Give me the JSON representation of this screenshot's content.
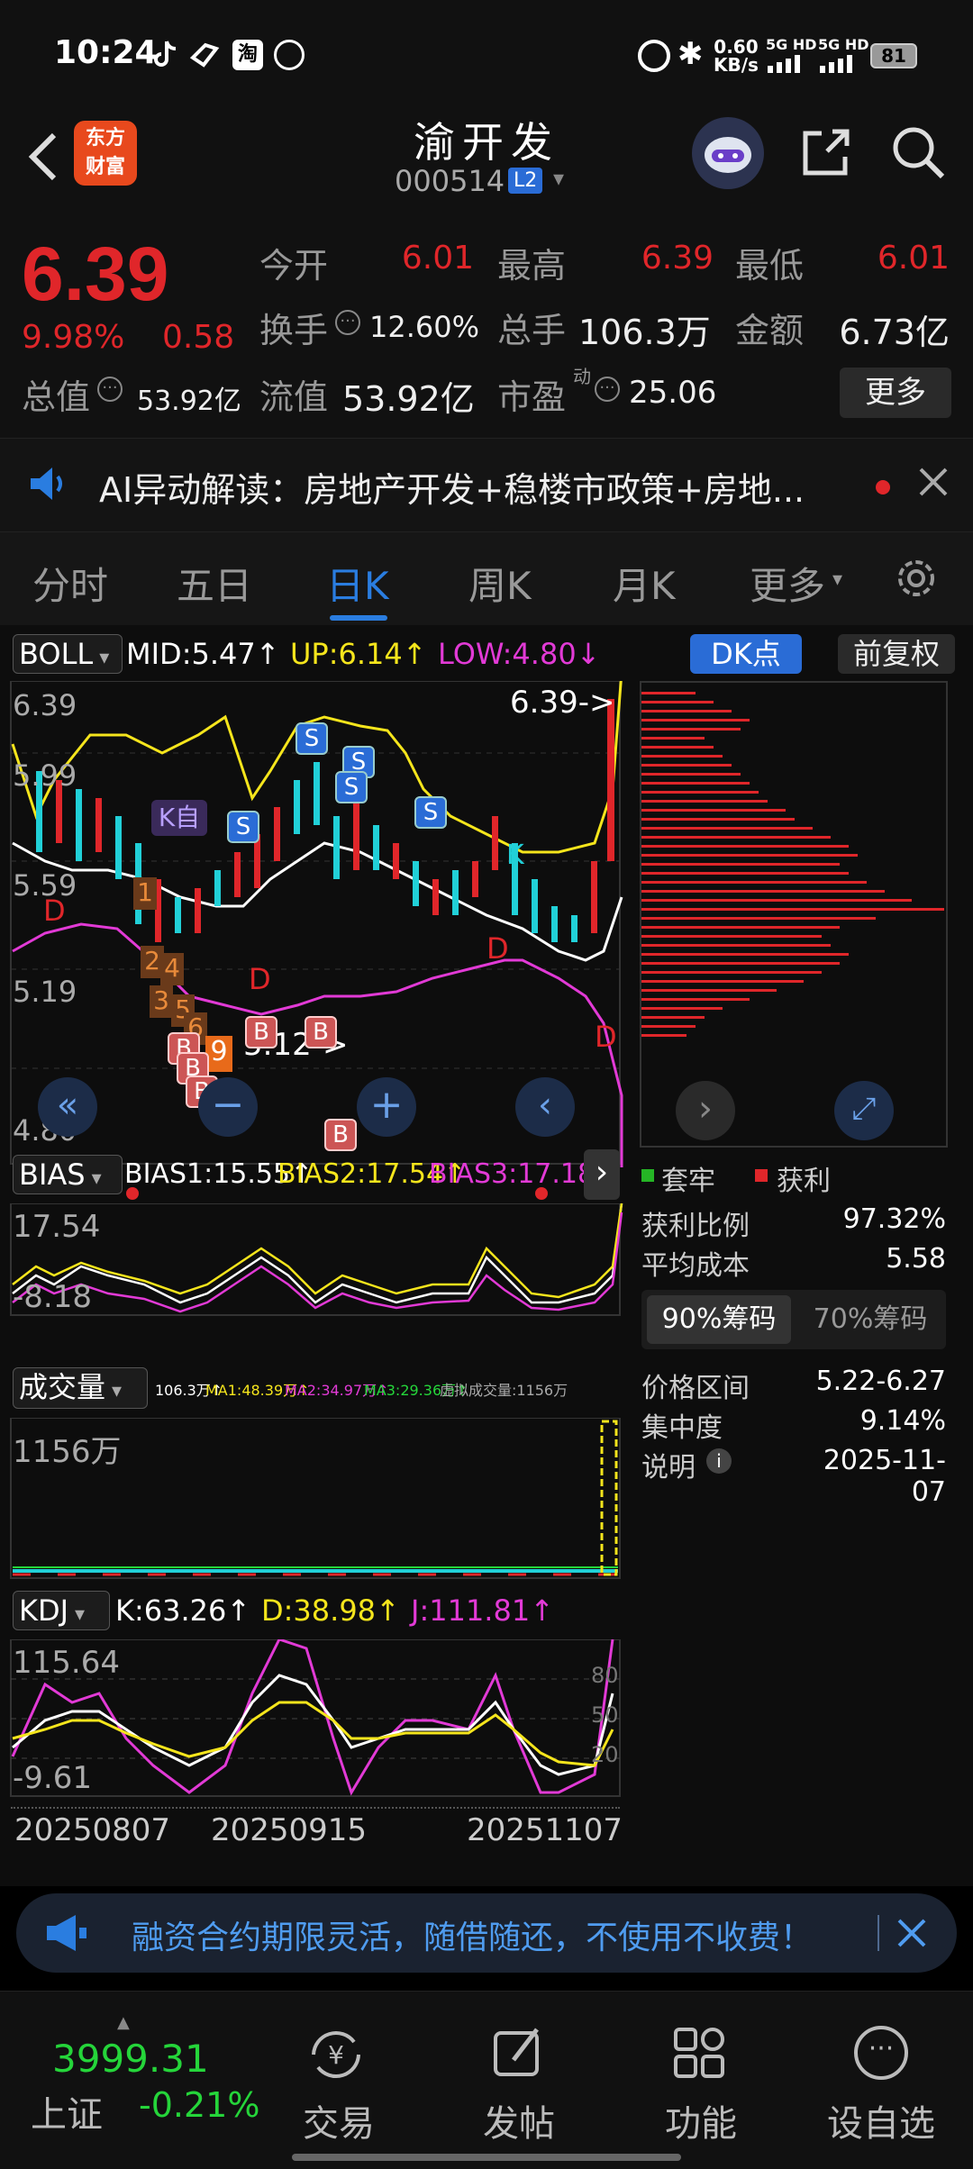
{
  "status": {
    "time": "10:24",
    "net_speed": "0.60",
    "net_unit": "KB/s",
    "sim1": "5G HD",
    "sim2": "5G HD",
    "battery": "81"
  },
  "header": {
    "logo_line1": "东方",
    "logo_line2": "财富",
    "stock_name": "渝开发",
    "stock_code": "000514",
    "level_badge": "L2"
  },
  "quote": {
    "price": "6.39",
    "change_pct": "9.98%",
    "change": "0.58",
    "open_label": "今开",
    "open": "6.01",
    "high_label": "最高",
    "high": "6.39",
    "low_label": "最低",
    "low": "6.01",
    "turnover_label": "换手",
    "turnover": "12.60%",
    "volume_label": "总手",
    "volume": "106.3万",
    "amount_label": "金额",
    "amount": "6.73亿",
    "mktcap_label": "总值",
    "mktcap": "53.92亿",
    "float_label": "流值",
    "float": "53.92亿",
    "pe_label": "市盈",
    "pe_sup": "动",
    "pe": "25.06",
    "more_button": "更多"
  },
  "ai_bar": {
    "text": "AI异动解读：房地产开发+稳楼市政策+房地..."
  },
  "tabs": [
    "分时",
    "五日",
    "日K",
    "周K",
    "月K",
    "更多"
  ],
  "active_tab": "日K",
  "boll": {
    "name": "BOLL",
    "mid": "MID:5.47↑",
    "up": "UP:6.14↑",
    "low": "LOW:4.80↓",
    "dk_button": "DK点",
    "adjust_button": "前复权",
    "y_top": "6.39",
    "y_2": "5.99",
    "y_3": "5.59",
    "y_4": "5.19",
    "y_bottom": "4.80",
    "price_arrow": "6.39->",
    "low_arrow": "5.12->",
    "mark_s": "S",
    "mark_b": "B",
    "mark_d": "D",
    "mark_k": "K",
    "mark_self": "K自",
    "num_1": "1",
    "num_2": "2",
    "num_3": "3",
    "num_4": "4",
    "num_5": "5",
    "num_6": "6",
    "num_9": "9"
  },
  "chips": {
    "legend_locked": "套牢",
    "legend_profit": "获利",
    "profit_ratio_label": "获利比例",
    "profit_ratio": "97.32%",
    "avg_cost_label": "平均成本",
    "avg_cost": "5.58",
    "tab_90": "90%筹码",
    "tab_70": "70%筹码",
    "range_label": "价格区间",
    "range": "5.22-6.27",
    "concentration_label": "集中度",
    "concentration": "9.14%",
    "note_label": "说明",
    "date": "2025-11-07"
  },
  "bias": {
    "name": "BIAS",
    "b1": "BIAS1:15.55↑",
    "b2": "BIAS2:17.54↑",
    "b3": "BIAS3:17.18↑",
    "y_top": "17.54",
    "y_bottom": "-8.18"
  },
  "volume": {
    "name": "成交量",
    "v": "106.3万↑",
    "ma1": "MA1:48.39万↑",
    "ma2": "MA2:34.97万↑",
    "ma3": "MA3:29.36万↑",
    "virtual": "虚拟成交量:1156万",
    "y_top": "1156万"
  },
  "kdj": {
    "name": "KDJ",
    "k": "K:63.26↑",
    "d": "D:38.98↑",
    "j": "J:111.81↑",
    "y_top": "115.64",
    "y_bottom": "-9.61",
    "level_80": "80",
    "level_50": "50",
    "level_20": "20"
  },
  "dates": [
    "20250807",
    "20250915",
    "20251107"
  ],
  "ad": {
    "text": "融资合约期限灵活，随借随还，不使用不收费！"
  },
  "bottom_nav": {
    "index_value": "3999.31",
    "index_name": "上证",
    "index_change": "-0.21%",
    "trade": "交易",
    "post": "发帖",
    "function": "功能",
    "watchlist": "设自选"
  },
  "colors": {
    "up": "#e0262a",
    "down": "#21d0d8",
    "accent": "#2a7de0",
    "yellow": "#f5e51c",
    "magenta": "#e23ad6"
  }
}
